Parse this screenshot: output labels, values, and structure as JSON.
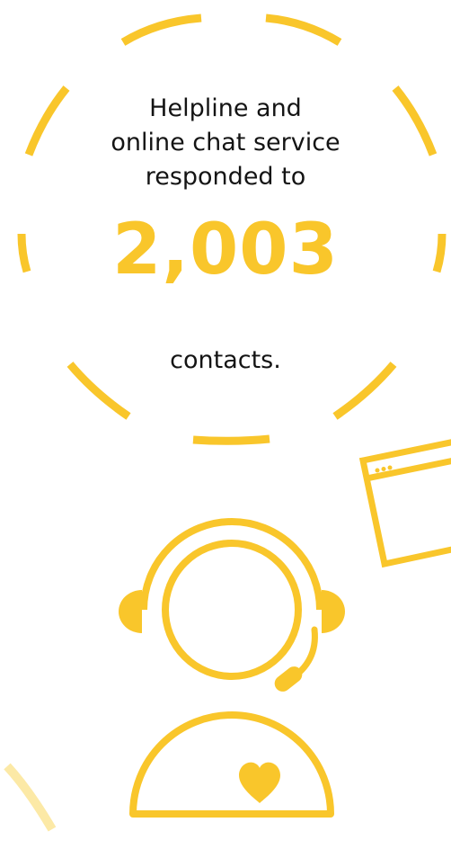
{
  "stat": {
    "intro_lines": [
      "Helpline and",
      "online chat service",
      "responded to"
    ],
    "number": "2,003",
    "outro": "contacts."
  },
  "colors": {
    "accent": "#F9C62B",
    "accent_faded": "#FCE9A6",
    "text": "#141414",
    "background": "#FFFFFF"
  },
  "icons": [
    "dashed-circle-frame",
    "browser-window-icon",
    "headset-agent-icon",
    "heart-icon",
    "decorative-arc"
  ]
}
